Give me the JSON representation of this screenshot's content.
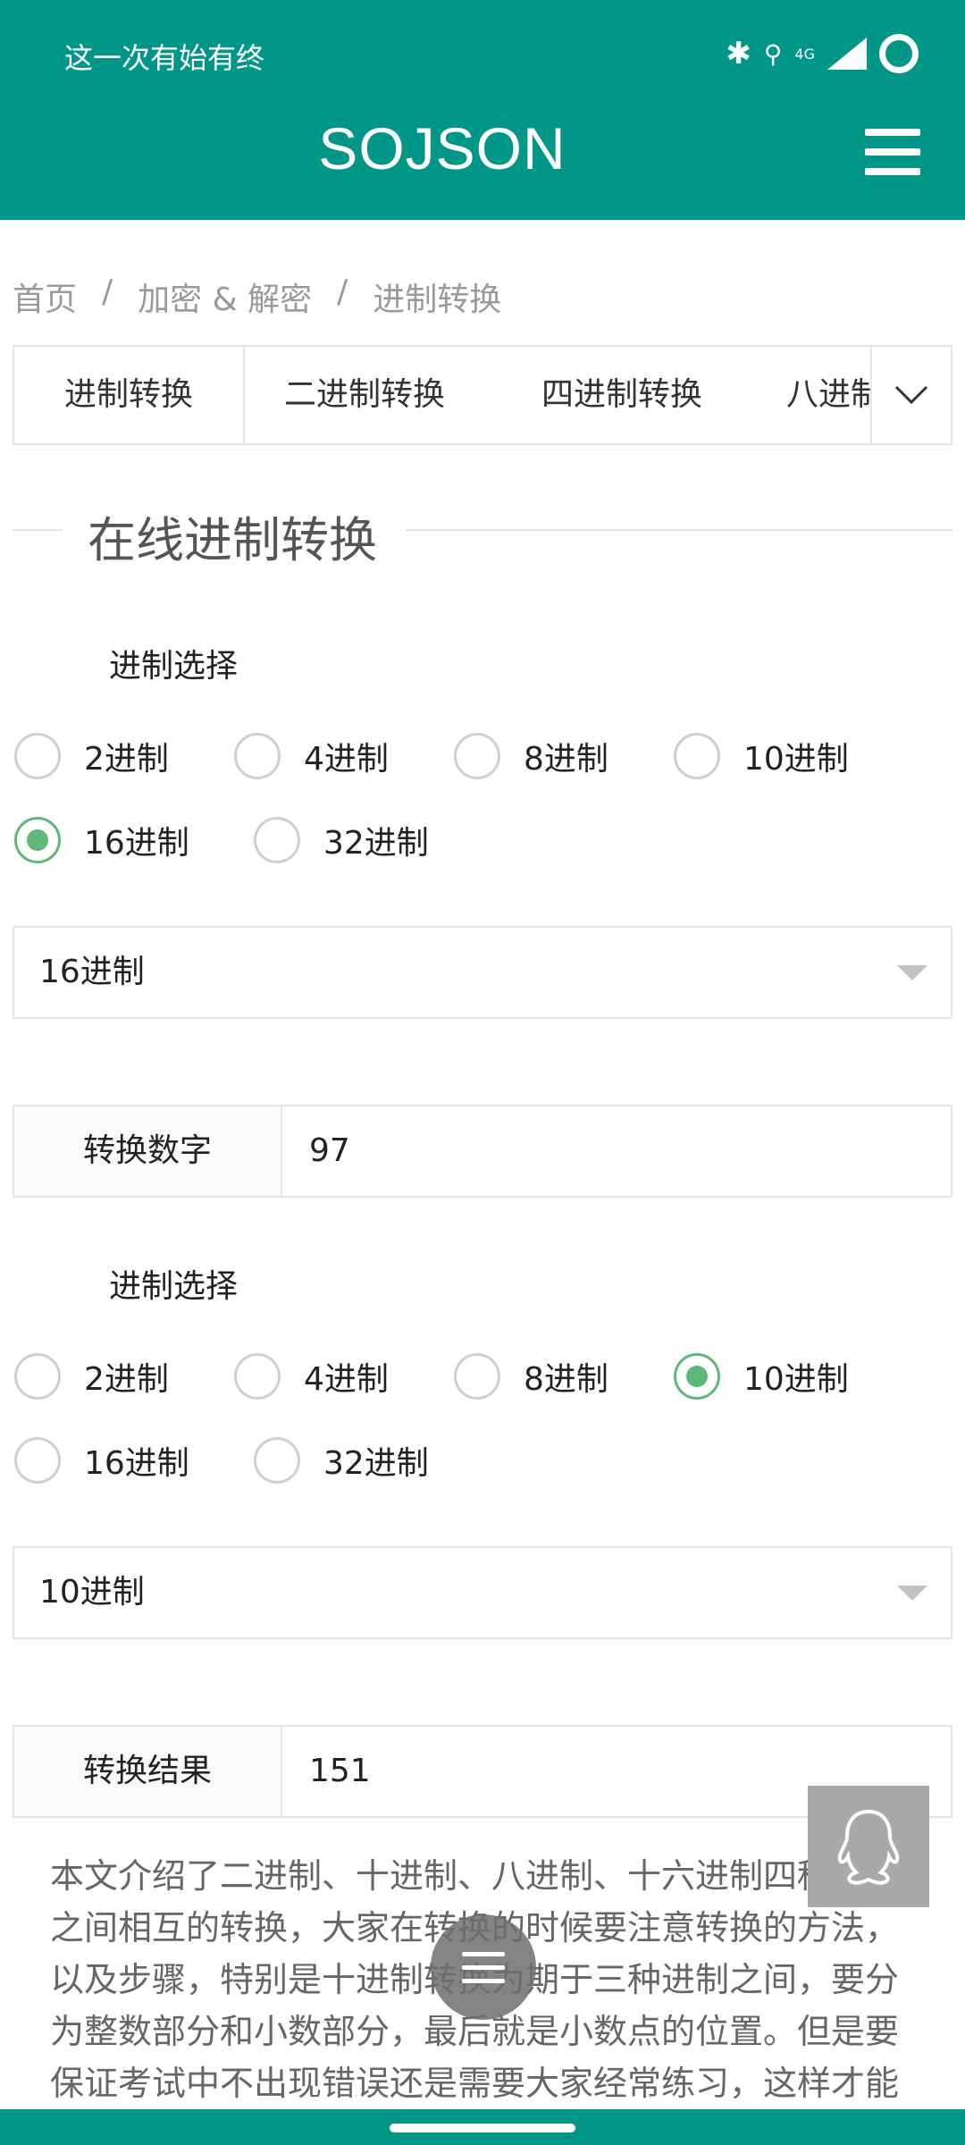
{
  "status_bar": {
    "text": "这一次有始有终",
    "network": "4G"
  },
  "header": {
    "brand": "SOJSON",
    "bg_color": "#009688",
    "menu_icon": "hamburger-icon"
  },
  "breadcrumb": {
    "items": [
      "首页",
      "加密 & 解密",
      "进制转换"
    ],
    "separator": "/"
  },
  "tabs": {
    "items": [
      "进制转换",
      "二进制转换",
      "四进制转换",
      "八进制"
    ],
    "active_index": 0
  },
  "section": {
    "title": "在线进制转换"
  },
  "from_base": {
    "label": "进制选择",
    "options": [
      "2进制",
      "4进制",
      "8进制",
      "10进制",
      "16进制",
      "32进制"
    ],
    "selected": "16进制",
    "select_value": "16进制"
  },
  "input": {
    "label": "转换数字",
    "value": "97"
  },
  "to_base": {
    "label": "进制选择",
    "options": [
      "2进制",
      "4进制",
      "8进制",
      "10进制",
      "16进制",
      "32进制"
    ],
    "selected": "10进制",
    "select_value": "10进制"
  },
  "result": {
    "label": "转换结果",
    "value": "151"
  },
  "description": "本文介绍了二进制、十进制、八进制、十六进制四种进制之间相互的转换，大家在转换的时候要注意转换的方法，以及步骤，特别是十进制转换为期于三种进制之间，要分为整数部分和小数部分，最后就是小数点的位置。但是要保证考试中不出现错误还是需要大家经常练习，这样才能",
  "colors": {
    "accent": "#5fb878",
    "border": "#e6e6e6",
    "muted": "#9a9a9a"
  }
}
